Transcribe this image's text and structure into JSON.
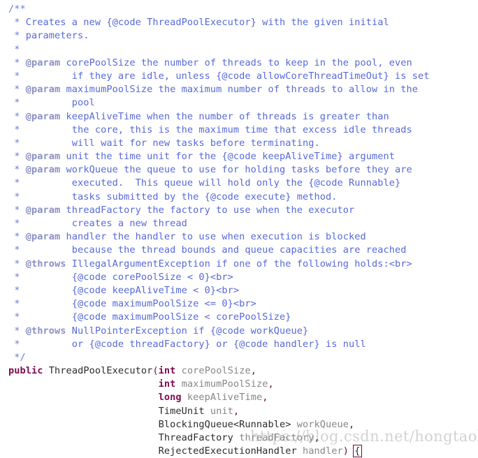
{
  "editor": {
    "background": "#ffffff",
    "language": "java",
    "font_size_px": 13.6,
    "line_height_px": 19.2
  },
  "colors": {
    "comment": "#5769d8",
    "comment_punct": "#6b7bdd",
    "javadoc_tag": "#8a90c4",
    "keyword": "#7c0b52",
    "type": "#2b2b2b",
    "variable": "#868686",
    "punctuation": "#6a0d45",
    "bracket_match_border": "#6a0d45",
    "watermark": "#d2d2d2"
  },
  "watermark": {
    "text": "https://blog.csdn.net/hongtaolong"
  },
  "code": {
    "lines": [
      [
        {
          "c": "cmt-punct",
          "t": "/**"
        }
      ],
      [
        {
          "c": "cmt-punct",
          "t": " * "
        },
        {
          "c": "cmt",
          "t": "Creates a new {@code ThreadPoolExecutor} with the given initial"
        }
      ],
      [
        {
          "c": "cmt-punct",
          "t": " * "
        },
        {
          "c": "cmt",
          "t": "parameters."
        }
      ],
      [
        {
          "c": "cmt-punct",
          "t": " *"
        }
      ],
      [
        {
          "c": "cmt-punct",
          "t": " * "
        },
        {
          "c": "tag",
          "t": "@param"
        },
        {
          "c": "cmt",
          "t": " corePoolSize the number of threads to keep in the pool, even"
        }
      ],
      [
        {
          "c": "cmt-punct",
          "t": " * "
        },
        {
          "c": "cmt",
          "t": "        if they are idle, unless {@code allowCoreThreadTimeOut} is set"
        }
      ],
      [
        {
          "c": "cmt-punct",
          "t": " * "
        },
        {
          "c": "tag",
          "t": "@param"
        },
        {
          "c": "cmt",
          "t": " maximumPoolSize the maximum number of threads to allow in the"
        }
      ],
      [
        {
          "c": "cmt-punct",
          "t": " * "
        },
        {
          "c": "cmt",
          "t": "        pool"
        }
      ],
      [
        {
          "c": "cmt-punct",
          "t": " * "
        },
        {
          "c": "tag",
          "t": "@param"
        },
        {
          "c": "cmt",
          "t": " keepAliveTime when the number of threads is greater than"
        }
      ],
      [
        {
          "c": "cmt-punct",
          "t": " * "
        },
        {
          "c": "cmt",
          "t": "        the core, this is the maximum time that excess idle threads"
        }
      ],
      [
        {
          "c": "cmt-punct",
          "t": " * "
        },
        {
          "c": "cmt",
          "t": "        will wait for new tasks before terminating."
        }
      ],
      [
        {
          "c": "cmt-punct",
          "t": " * "
        },
        {
          "c": "tag",
          "t": "@param"
        },
        {
          "c": "cmt",
          "t": " unit the time unit for the {@code keepAliveTime} argument"
        }
      ],
      [
        {
          "c": "cmt-punct",
          "t": " * "
        },
        {
          "c": "tag",
          "t": "@param"
        },
        {
          "c": "cmt",
          "t": " workQueue the queue to use for holding tasks before they are"
        }
      ],
      [
        {
          "c": "cmt-punct",
          "t": " * "
        },
        {
          "c": "cmt",
          "t": "        executed.  This queue will hold only the {@code Runnable}"
        }
      ],
      [
        {
          "c": "cmt-punct",
          "t": " * "
        },
        {
          "c": "cmt",
          "t": "        tasks submitted by the {@code execute} method."
        }
      ],
      [
        {
          "c": "cmt-punct",
          "t": " * "
        },
        {
          "c": "tag",
          "t": "@param"
        },
        {
          "c": "cmt",
          "t": " threadFactory the factory to use when the executor"
        }
      ],
      [
        {
          "c": "cmt-punct",
          "t": " * "
        },
        {
          "c": "cmt",
          "t": "        creates a new thread"
        }
      ],
      [
        {
          "c": "cmt-punct",
          "t": " * "
        },
        {
          "c": "tag",
          "t": "@param"
        },
        {
          "c": "cmt",
          "t": " handler the handler to use when execution is blocked"
        }
      ],
      [
        {
          "c": "cmt-punct",
          "t": " * "
        },
        {
          "c": "cmt",
          "t": "        because the thread bounds and queue capacities are reached"
        }
      ],
      [
        {
          "c": "cmt-punct",
          "t": " * "
        },
        {
          "c": "tag",
          "t": "@throws"
        },
        {
          "c": "cmt",
          "t": " IllegalArgumentException if one of the following holds:<br>"
        }
      ],
      [
        {
          "c": "cmt-punct",
          "t": " * "
        },
        {
          "c": "cmt",
          "t": "        {@code corePoolSize < 0}<br>"
        }
      ],
      [
        {
          "c": "cmt-punct",
          "t": " * "
        },
        {
          "c": "cmt",
          "t": "        {@code keepAliveTime < 0}<br>"
        }
      ],
      [
        {
          "c": "cmt-punct",
          "t": " * "
        },
        {
          "c": "cmt",
          "t": "        {@code maximumPoolSize <= 0}<br>"
        }
      ],
      [
        {
          "c": "cmt-punct",
          "t": " * "
        },
        {
          "c": "cmt",
          "t": "        {@code maximumPoolSize < corePoolSize}"
        }
      ],
      [
        {
          "c": "cmt-punct",
          "t": " * "
        },
        {
          "c": "tag",
          "t": "@throws"
        },
        {
          "c": "cmt",
          "t": " NullPointerException if {@code workQueue}"
        }
      ],
      [
        {
          "c": "cmt-punct",
          "t": " * "
        },
        {
          "c": "cmt",
          "t": "        or {@code threadFactory} or {@code handler} is null"
        }
      ],
      [
        {
          "c": "cmt-punct",
          "t": " */"
        }
      ],
      [
        {
          "c": "kw",
          "t": "public"
        },
        {
          "c": "plain",
          "t": " "
        },
        {
          "c": "type",
          "t": "ThreadPoolExecutor"
        },
        {
          "c": "punct",
          "t": "("
        },
        {
          "c": "kw",
          "t": "int"
        },
        {
          "c": "plain",
          "t": " "
        },
        {
          "c": "var",
          "t": "corePoolSize"
        },
        {
          "c": "punct",
          "t": ","
        }
      ],
      [
        {
          "c": "plain",
          "t": "                          "
        },
        {
          "c": "kw",
          "t": "int"
        },
        {
          "c": "plain",
          "t": " "
        },
        {
          "c": "var",
          "t": "maximumPoolSize"
        },
        {
          "c": "punct",
          "t": ","
        }
      ],
      [
        {
          "c": "plain",
          "t": "                          "
        },
        {
          "c": "kw",
          "t": "long"
        },
        {
          "c": "plain",
          "t": " "
        },
        {
          "c": "var",
          "t": "keepAliveTime"
        },
        {
          "c": "punct",
          "t": ","
        }
      ],
      [
        {
          "c": "plain",
          "t": "                          "
        },
        {
          "c": "type",
          "t": "TimeUnit"
        },
        {
          "c": "plain",
          "t": " "
        },
        {
          "c": "var",
          "t": "unit"
        },
        {
          "c": "punct",
          "t": ","
        }
      ],
      [
        {
          "c": "plain",
          "t": "                          "
        },
        {
          "c": "type",
          "t": "BlockingQueue<Runnable>"
        },
        {
          "c": "plain",
          "t": " "
        },
        {
          "c": "var",
          "t": "workQueue"
        },
        {
          "c": "punct",
          "t": ","
        }
      ],
      [
        {
          "c": "plain",
          "t": "                          "
        },
        {
          "c": "type",
          "t": "ThreadFactory"
        },
        {
          "c": "plain",
          "t": " "
        },
        {
          "c": "var",
          "t": "threadFactory"
        },
        {
          "c": "punct",
          "t": ","
        }
      ],
      [
        {
          "c": "plain",
          "t": "                          "
        },
        {
          "c": "type",
          "t": "RejectedExecutionHandler"
        },
        {
          "c": "plain",
          "t": " "
        },
        {
          "c": "var",
          "t": "handler"
        },
        {
          "c": "punct",
          "t": ")"
        },
        {
          "c": "plain",
          "t": " "
        },
        {
          "c": "brace-hl",
          "t": "{"
        }
      ]
    ]
  }
}
